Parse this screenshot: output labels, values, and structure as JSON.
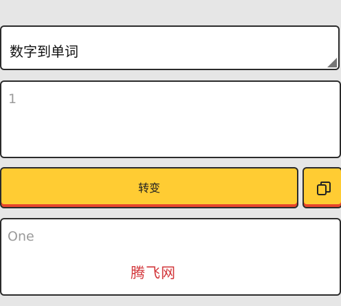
{
  "mode_select": {
    "selected": "数字到单词"
  },
  "input": {
    "value": "1"
  },
  "actions": {
    "convert_label": "转变"
  },
  "output": {
    "value": "One",
    "watermark": "腾飞网"
  },
  "icons": {
    "copy": "copy-icon",
    "dropdown": "resize-corner-icon"
  },
  "colors": {
    "button": "#ffcc33",
    "button_accent": "#e8452c",
    "watermark": "#d2363a"
  }
}
